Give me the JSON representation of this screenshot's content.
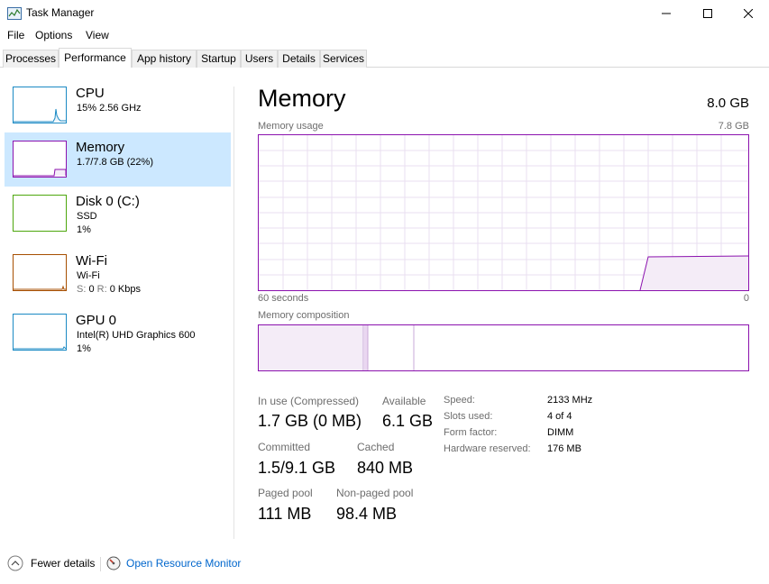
{
  "window": {
    "title": "Task Manager",
    "minimize_icon": "minimize-icon",
    "maximize_icon": "maximize-icon",
    "close_icon": "close-icon"
  },
  "menu": [
    "File",
    "Options",
    "View"
  ],
  "tabs": [
    "Processes",
    "Performance",
    "App history",
    "Startup",
    "Users",
    "Details",
    "Services"
  ],
  "active_tab": "Performance",
  "sidebar": [
    {
      "name": "CPU",
      "line1": "15%  2.56 GHz",
      "line2": "",
      "color": "#1b8ac4",
      "selected": false
    },
    {
      "name": "Memory",
      "line1": "1.7/7.8 GB (22%)",
      "line2": "",
      "color": "#8b12ae",
      "selected": true
    },
    {
      "name": "Disk 0 (C:)",
      "line1": "SSD",
      "line2": "1%",
      "color": "#4da60c",
      "selected": false
    },
    {
      "name": "Wi-Fi",
      "line1": "Wi-Fi",
      "line2_s_label": "S:",
      "line2_s_value": "0",
      "line2_r_label": "R:",
      "line2_r_value": "0 Kbps",
      "color": "#a74f01",
      "selected": false
    },
    {
      "name": "GPU 0",
      "line1": "Intel(R) UHD Graphics 600",
      "line2": "1%",
      "color": "#1b8ac4",
      "selected": false
    }
  ],
  "main": {
    "title": "Memory",
    "capacity": "8.0 GB",
    "usage_label": "Memory usage",
    "usage_max": "7.8 GB",
    "time_left": "60 seconds",
    "time_right": "0",
    "composition_label": "Memory composition",
    "stats": {
      "in_use_label": "In use (Compressed)",
      "in_use_value": "1.7 GB (0 MB)",
      "available_label": "Available",
      "available_value": "6.1 GB",
      "committed_label": "Committed",
      "committed_value": "1.5/9.1 GB",
      "cached_label": "Cached",
      "cached_value": "840 MB",
      "paged_label": "Paged pool",
      "paged_value": "111 MB",
      "nonpaged_label": "Non-paged pool",
      "nonpaged_value": "98.4 MB"
    },
    "specs": [
      {
        "label": "Speed:",
        "value": "2133 MHz"
      },
      {
        "label": "Slots used:",
        "value": "4 of 4"
      },
      {
        "label": "Form factor:",
        "value": "DIMM"
      },
      {
        "label": "Hardware reserved:",
        "value": "176 MB"
      }
    ]
  },
  "footer": {
    "fewer_details": "Fewer details",
    "resource_monitor": "Open Resource Monitor",
    "fewer_icon": "chevron-up-icon",
    "monitor_icon": "resource-monitor-icon"
  },
  "colors": {
    "memory_accent": "#8b12ae",
    "selected_bg": "#cce8ff",
    "link": "#0066cc"
  }
}
